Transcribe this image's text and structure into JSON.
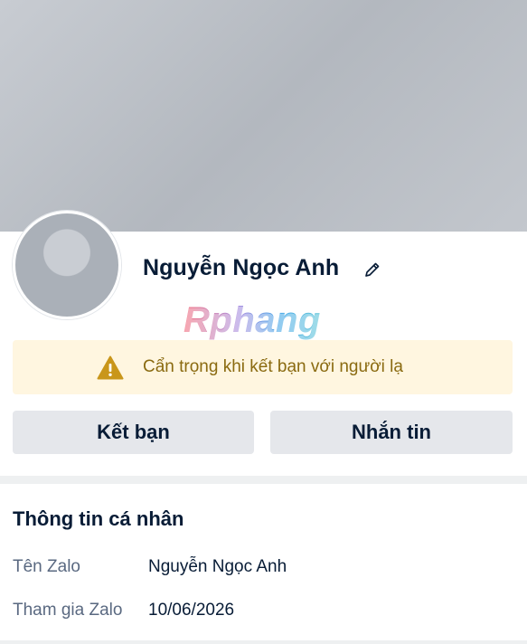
{
  "profile": {
    "name": "Nguyễn Ngọc Anh",
    "watermark": "Rphang"
  },
  "warning": {
    "text": "Cẩn trọng khi kết bạn với người lạ"
  },
  "actions": {
    "add_friend_label": "Kết bạn",
    "message_label": "Nhắn tin"
  },
  "personal_info": {
    "title": "Thông tin cá nhân",
    "rows": [
      {
        "label": "Tên Zalo",
        "value": "Nguyễn Ngọc Anh"
      },
      {
        "label": "Tham gia Zalo",
        "value": "10/06/2026"
      }
    ]
  },
  "colors": {
    "warning_bg": "#fff6e0",
    "warning_icon": "#c9961a",
    "button_bg": "#e5e7eb",
    "text_primary": "#081c36",
    "text_secondary": "#5a6981"
  },
  "icons": {
    "edit": "pencil-icon",
    "warning": "warning-triangle-icon"
  }
}
